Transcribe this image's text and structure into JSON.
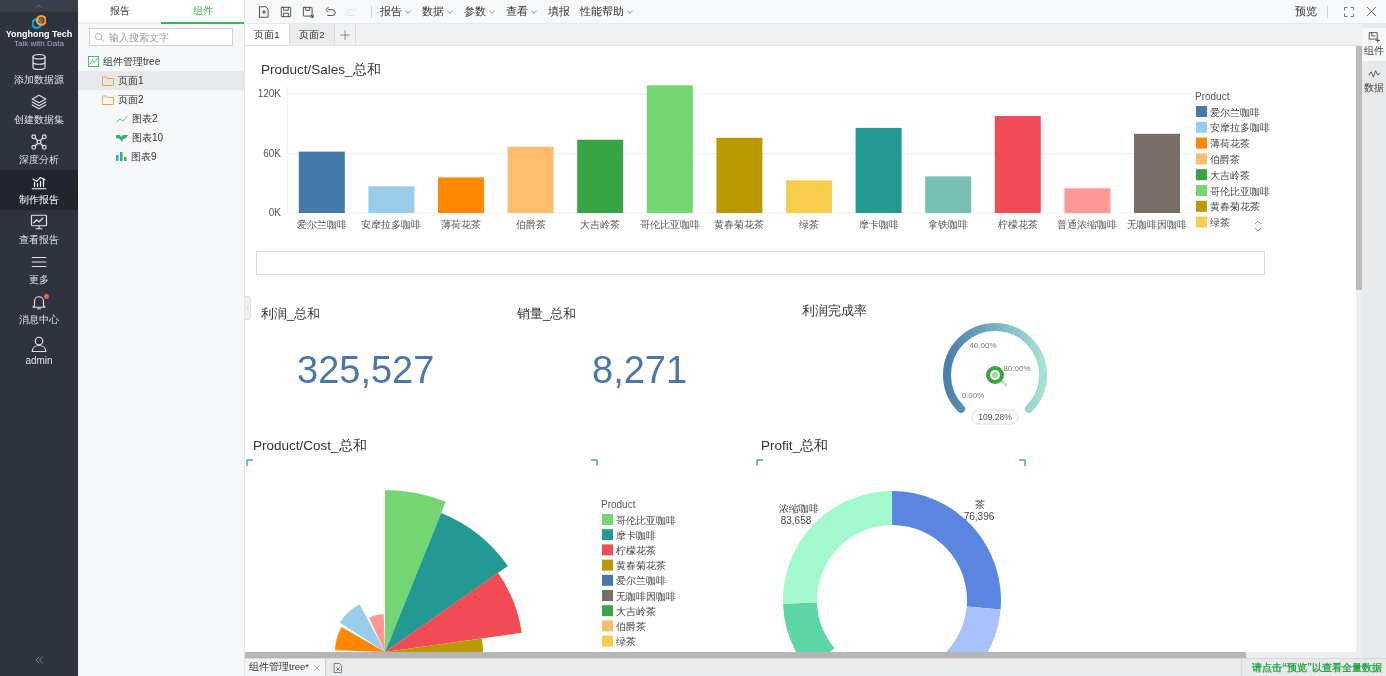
{
  "nav": {
    "logo": {
      "name": "Yonghong Tech",
      "tagline": "Talk with Data"
    },
    "items": [
      {
        "label": "添加数据源",
        "kind": "database",
        "selected": false,
        "badge": false
      },
      {
        "label": "创建数据集",
        "kind": "layers",
        "selected": false,
        "badge": false
      },
      {
        "label": "深度分析",
        "kind": "network",
        "selected": false,
        "badge": false
      },
      {
        "label": "制作报告",
        "kind": "chart",
        "selected": true,
        "badge": false
      },
      {
        "label": "查看报告",
        "kind": "monitor",
        "selected": false,
        "badge": false
      },
      {
        "label": "更多",
        "kind": "menu",
        "selected": false,
        "badge": false
      },
      {
        "label": "消息中心",
        "kind": "bell",
        "selected": false,
        "badge": true
      },
      {
        "label": "admin",
        "kind": "user",
        "selected": false,
        "badge": false
      }
    ]
  },
  "panel": {
    "tabs": [
      {
        "label": "报告",
        "selected": false
      },
      {
        "label": "组件",
        "selected": true
      }
    ],
    "search": {
      "placeholder": "输入搜索文字"
    },
    "tree": [
      {
        "label": "组件管理tree",
        "kind": "report",
        "selected": false,
        "children": [
          {
            "label": "页面1",
            "kind": "folder",
            "selected": true
          },
          {
            "label": "页面2",
            "kind": "folder",
            "selected": false,
            "children": [
              {
                "label": "图表2",
                "kind": "line",
                "selected": false
              },
              {
                "label": "图表10",
                "kind": "map",
                "selected": false
              },
              {
                "label": "图表9",
                "kind": "bar",
                "selected": false
              }
            ]
          }
        ]
      }
    ]
  },
  "toolbar": {
    "actions": [
      {
        "kind": "new",
        "disabled": false
      },
      {
        "kind": "save",
        "disabled": false
      },
      {
        "kind": "save_as",
        "disabled": false
      },
      {
        "kind": "undo",
        "disabled": false
      },
      {
        "kind": "redo",
        "disabled": true
      }
    ],
    "menus": [
      {
        "label": "报告",
        "dropdown": true
      },
      {
        "label": "数据",
        "dropdown": true
      },
      {
        "label": "参数",
        "dropdown": true
      },
      {
        "label": "查看",
        "dropdown": true
      },
      {
        "label": "填报",
        "dropdown": false
      },
      {
        "label": "性能帮助",
        "dropdown": true
      }
    ],
    "preview": "预览"
  },
  "page_tabs": [
    {
      "label": "页面1",
      "selected": true
    },
    {
      "label": "页面2",
      "selected": false
    }
  ],
  "right_strip": [
    {
      "label": "组件",
      "kind": "component",
      "selected": true
    },
    {
      "label": "数据",
      "kind": "data",
      "selected": false
    }
  ],
  "canvas": {
    "sales_chart": {
      "title": "Product/Sales_总和",
      "chart_data": {
        "type": "bar",
        "categories": [
          "爱尔兰咖啡",
          "安摩拉多咖啡",
          "薄荷花茶",
          "伯爵茶",
          "大吉岭茶",
          "哥伦比亚咖啡",
          "黄春菊花茶",
          "绿茶",
          "摩卡咖啡",
          "拿铁咖啡",
          "柠檬花茶",
          "普通浓缩咖啡",
          "无咖啡因咖啡"
        ],
        "values": [
          62000,
          27000,
          36000,
          67000,
          74000,
          129000,
          76000,
          33000,
          86000,
          37000,
          98000,
          25000,
          80000
        ],
        "colors": [
          "#4479ab",
          "#97cde9",
          "#ff8800",
          "#ffbb6e",
          "#38a443",
          "#74d573",
          "#bb9900",
          "#f7cd4d",
          "#229a92",
          "#78bfb4",
          "#f14b55",
          "#ff9999",
          "#786d69"
        ],
        "ylim": [
          0,
          130000
        ],
        "yticks": [
          {
            "value": 0,
            "label": "0K"
          },
          {
            "value": 60000,
            "label": "60K"
          },
          {
            "value": 120000,
            "label": "120K"
          }
        ]
      },
      "legend": {
        "title": "Product",
        "items": [
          {
            "label": "爱尔兰咖啡",
            "color": "#4479ab"
          },
          {
            "label": "安摩拉多咖啡",
            "color": "#97cde9"
          },
          {
            "label": "薄荷花茶",
            "color": "#ff8800"
          },
          {
            "label": "伯爵茶",
            "color": "#ffbb6e"
          },
          {
            "label": "大吉岭茶",
            "color": "#38a443"
          },
          {
            "label": "哥伦比亚咖啡",
            "color": "#74d573"
          },
          {
            "label": "黄春菊花茶",
            "color": "#bb9900"
          },
          {
            "label": "绿茶",
            "color": "#f7cd4d"
          }
        ]
      }
    },
    "kpis": [
      {
        "title": "利润_总和",
        "value": "325,527"
      },
      {
        "title": "销量_总和",
        "value": "8,271"
      }
    ],
    "gauge": {
      "title": "利润完成率",
      "ticks": [
        "0.00%",
        "40.00%",
        "80.00%"
      ],
      "reading": "109.28%"
    },
    "cost_chart": {
      "title": "Product/Cost_总和",
      "legend": {
        "title": "Product",
        "items": [
          {
            "label": "哥伦比亚咖啡",
            "color": "#74d573"
          },
          {
            "label": "摩卡咖啡",
            "color": "#229a92"
          },
          {
            "label": "柠檬花茶",
            "color": "#f14b55"
          },
          {
            "label": "黄春菊花茶",
            "color": "#bb9900"
          },
          {
            "label": "爱尔兰咖啡",
            "color": "#4479ab"
          },
          {
            "label": "无咖啡因咖啡",
            "color": "#786d69"
          },
          {
            "label": "大吉岭茶",
            "color": "#38a443"
          },
          {
            "label": "伯爵茶",
            "color": "#ffbb6e"
          },
          {
            "label": "绿茶",
            "color": "#f7cd4d"
          }
        ]
      }
    },
    "profit_chart": {
      "title": "Profit_总和",
      "labels": [
        {
          "name": "浓缩咖啡",
          "value": "83,658"
        },
        {
          "name": "茶",
          "value": "76,396"
        }
      ]
    }
  },
  "bottom_bar": {
    "document_tab": "组件管理tree*",
    "status": "请点击“预览”以查看全量数据"
  }
}
